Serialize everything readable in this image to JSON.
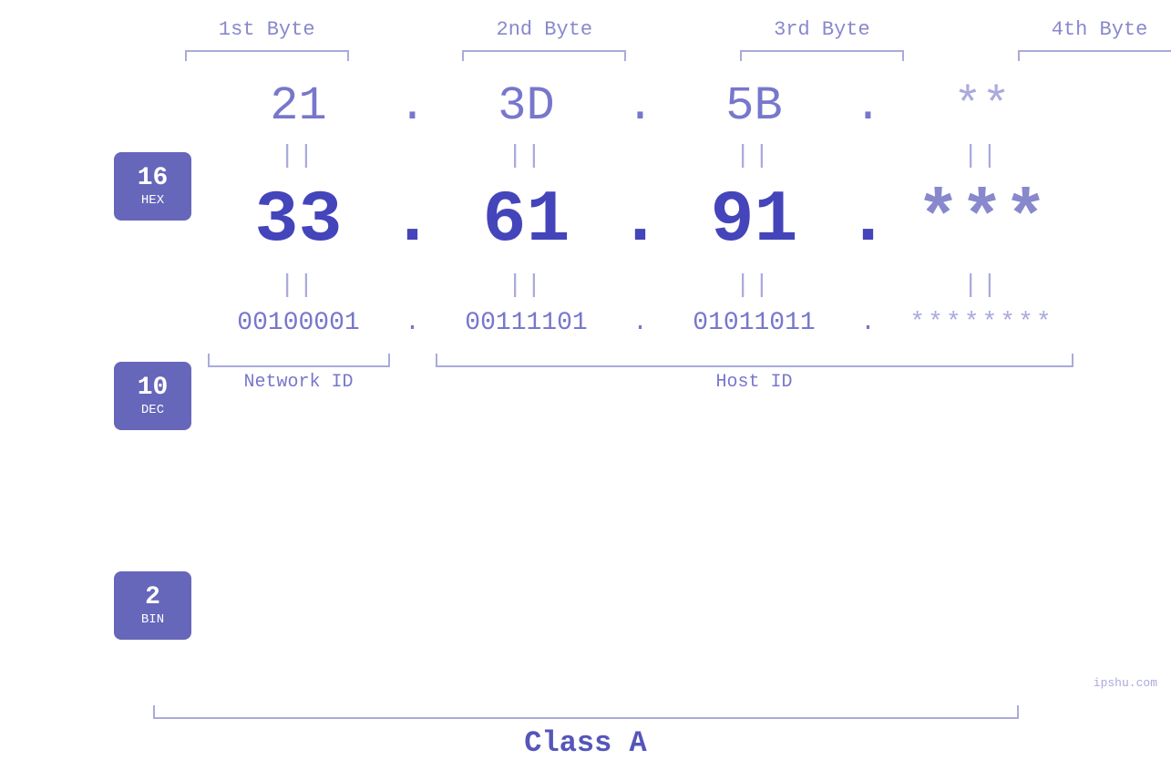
{
  "headers": {
    "byte1": "1st Byte",
    "byte2": "2nd Byte",
    "byte3": "3rd Byte",
    "byte4": "4th Byte"
  },
  "badges": {
    "hex": {
      "num": "16",
      "name": "HEX"
    },
    "dec": {
      "num": "10",
      "name": "DEC"
    },
    "bin": {
      "num": "2",
      "name": "BIN"
    }
  },
  "hex_row": {
    "b1": "21",
    "b2": "3D",
    "b3": "5B",
    "b4": "**",
    "dot": "."
  },
  "dec_row": {
    "b1": "33",
    "b2": "61",
    "b3": "91",
    "b4": "***",
    "dot": "."
  },
  "bin_row": {
    "b1": "00100001",
    "b2": "00111101",
    "b3": "01011011",
    "b4": "********",
    "dot": "."
  },
  "equals": "||",
  "labels": {
    "network_id": "Network ID",
    "host_id": "Host ID",
    "class": "Class A"
  },
  "watermark": "ipshu.com",
  "colors": {
    "badge_bg": "#6666bb",
    "primary_text": "#4444bb",
    "secondary_text": "#7777cc",
    "muted_text": "#aaaadd",
    "bracket_color": "#aaaadd"
  }
}
